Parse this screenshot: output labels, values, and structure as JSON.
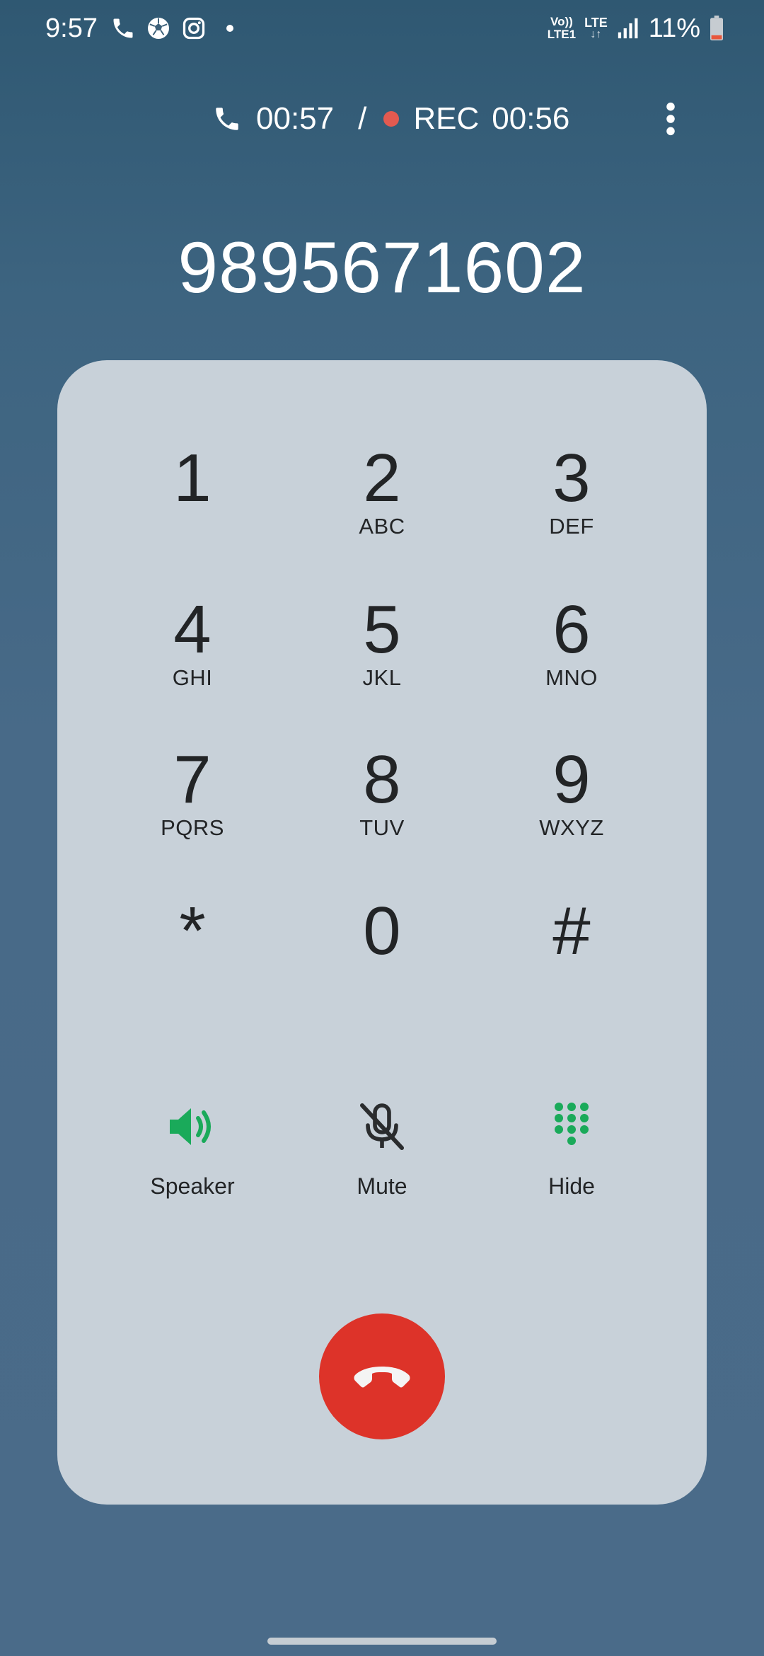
{
  "status_bar": {
    "time": "9:57",
    "volte_top": "Vo))",
    "volte_bottom": "LTE1",
    "network": "LTE",
    "network_arrows": "↓↑",
    "battery": "11%"
  },
  "call": {
    "duration": "00:57",
    "separator": "/",
    "rec_label": "REC",
    "rec_duration": "00:56",
    "number": "9895671602"
  },
  "keypad": [
    {
      "digit": "1",
      "letters": ""
    },
    {
      "digit": "2",
      "letters": "ABC"
    },
    {
      "digit": "3",
      "letters": "DEF"
    },
    {
      "digit": "4",
      "letters": "GHI"
    },
    {
      "digit": "5",
      "letters": "JKL"
    },
    {
      "digit": "6",
      "letters": "MNO"
    },
    {
      "digit": "7",
      "letters": "PQRS"
    },
    {
      "digit": "8",
      "letters": "TUV"
    },
    {
      "digit": "9",
      "letters": "WXYZ"
    },
    {
      "digit": "*",
      "letters": ""
    },
    {
      "digit": "0",
      "letters": ""
    },
    {
      "digit": "#",
      "letters": ""
    }
  ],
  "actions": {
    "speaker": "Speaker",
    "mute": "Mute",
    "hide": "Hide"
  },
  "colors": {
    "accent_green": "#1aaa5a",
    "end_call_red": "#dd3329",
    "rec_red": "#e35a50",
    "panel": "#c8d1d9"
  },
  "icons": {
    "status": [
      "phone-icon",
      "football-icon",
      "instagram-icon"
    ],
    "speaker": "speaker-icon",
    "mute": "mic-off-icon",
    "hide": "dialpad-icon",
    "end_call": "end-call-icon",
    "more": "more-vertical-icon"
  }
}
